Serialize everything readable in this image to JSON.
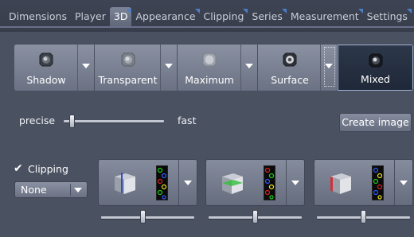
{
  "tabs": [
    {
      "label": "Dimensions"
    },
    {
      "label": "Player"
    },
    {
      "label": "3D"
    },
    {
      "label": "Appearance"
    },
    {
      "label": "Clipping"
    },
    {
      "label": "Series"
    },
    {
      "label": "Measurement"
    },
    {
      "label": "Settings"
    }
  ],
  "active_tab": "3D",
  "render_modes": [
    {
      "label": "Shadow",
      "icon": "sphere-shadow-icon"
    },
    {
      "label": "Transparent",
      "icon": "sphere-transparent-icon"
    },
    {
      "label": "Maximum",
      "icon": "sphere-maximum-icon"
    },
    {
      "label": "Surface",
      "icon": "sphere-surface-icon"
    },
    {
      "label": "Mixed",
      "icon": "sphere-mixed-icon"
    }
  ],
  "selected_render_mode": "Mixed",
  "speed": {
    "min_label": "precise",
    "max_label": "fast",
    "level": 0.08
  },
  "create_image_label": "Create image",
  "clipping": {
    "checkbox_label": "Clipping",
    "checked": true,
    "select_value": "None",
    "planes": [
      {
        "icon": "clip-plane-blue-icon",
        "slider_level": 0.45
      },
      {
        "icon": "clip-plane-green-icon",
        "slider_level": 0.5
      },
      {
        "icon": "clip-plane-red-icon",
        "slider_level": 0.5
      }
    ]
  },
  "colors": {
    "background": "#4a5161",
    "tab_accent": "#4b7ec9",
    "selected_mode": "#1f2838"
  }
}
